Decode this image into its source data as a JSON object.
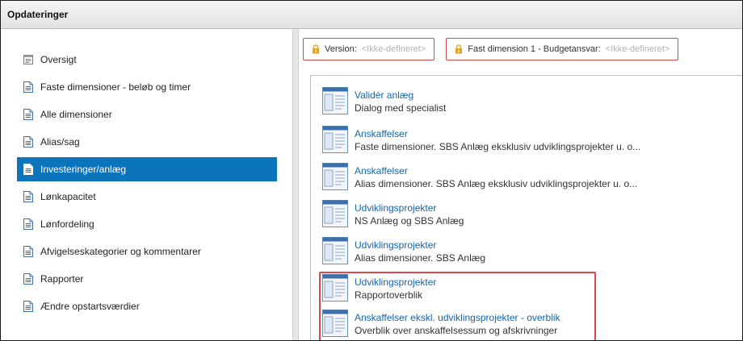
{
  "window": {
    "title": "Opdateringer"
  },
  "sidebar": {
    "items": [
      {
        "label": "Oversigt",
        "icon": "overview-icon"
      },
      {
        "label": "Faste dimensioner - beløb og timer",
        "icon": "document-icon"
      },
      {
        "label": "Alle dimensioner",
        "icon": "document-icon"
      },
      {
        "label": "Alias/sag",
        "icon": "document-icon"
      },
      {
        "label": "Investeringer/anlæg",
        "icon": "document-icon",
        "active": true
      },
      {
        "label": "Lønkapacitet",
        "icon": "document-icon"
      },
      {
        "label": "Lønfordeling",
        "icon": "document-icon"
      },
      {
        "label": "Afvigelseskategorier og kommentarer",
        "icon": "document-icon"
      },
      {
        "label": "Rapporter",
        "icon": "document-icon"
      },
      {
        "label": "Ændre opstartsværdier",
        "icon": "document-icon"
      }
    ]
  },
  "filters": [
    {
      "label": "Version:",
      "placeholder": "<Ikke-defineret>",
      "icon": "lock-icon"
    },
    {
      "label": "Fast dimension 1 - Budgetansvar:",
      "placeholder": "<Ikke-defineret>",
      "icon": "lock-icon"
    }
  ],
  "tiles": [
    {
      "title": "Validér anlæg",
      "subtitle": "Dialog med specialist"
    },
    {
      "title": "Anskaffelser",
      "subtitle": "Faste dimensioner. SBS Anlæg eksklusiv udviklingsprojekter u. o..."
    },
    {
      "title": "Anskaffelser",
      "subtitle": "Alias dimensioner. SBS Anlæg eksklusiv udviklingsprojekter u. o..."
    },
    {
      "title": "Udviklingsprojekter",
      "subtitle": "NS Anlæg og SBS Anlæg"
    },
    {
      "title": "Udviklingsprojekter",
      "subtitle": "Alias dimensioner. SBS Anlæg"
    },
    {
      "title": "Udviklingsprojekter",
      "subtitle": "Rapportoverblik"
    },
    {
      "title": "Anskaffelser ekskl. udviklingsprojekter - overblik",
      "subtitle": "Overblik over anskaffelsessum og afskrivninger"
    }
  ],
  "colors": {
    "active_nav": "#0b74ba",
    "link": "#1565a8",
    "highlight": "#e0474c",
    "lock": "#e8a21e"
  }
}
